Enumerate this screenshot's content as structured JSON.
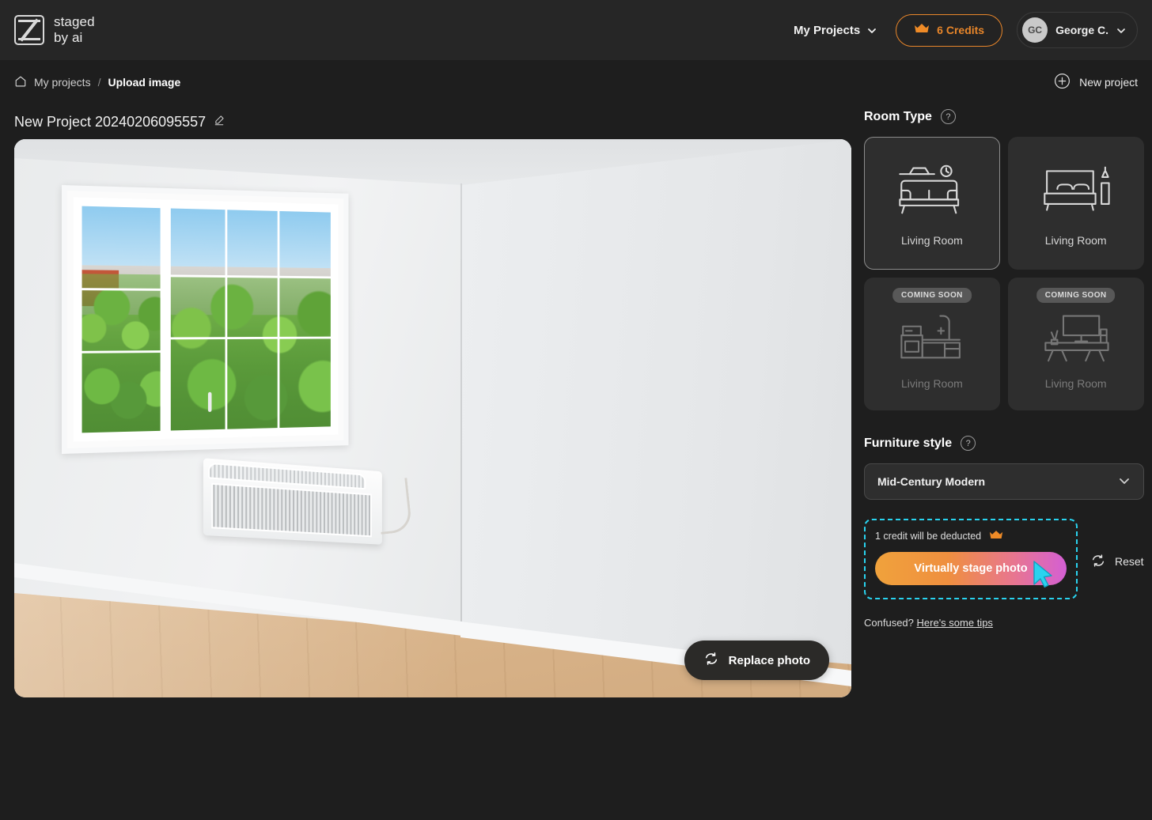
{
  "header": {
    "logo_line1": "staged",
    "logo_line2": "by ai",
    "logo_icon": "staged-by-ai-logo",
    "projects_menu": "My Projects",
    "credits_label": "6 Credits",
    "credits_icon": "crown-icon",
    "avatar_initials": "GC",
    "user_name": "George C.",
    "accent_orange": "#e8862a"
  },
  "breadcrumb": {
    "home_icon": "home-icon",
    "root": "My projects",
    "separator": "/",
    "current": "Upload image",
    "new_project": "New project",
    "new_project_icon": "plus-circle-icon"
  },
  "project": {
    "title": "New Project 20240206095557",
    "edit_icon": "pencil-icon"
  },
  "photo": {
    "replace_label": "Replace photo",
    "replace_icon": "refresh-icon",
    "alt": "Empty living room with white walls, large white grid window showing green foliage, wall mounted air conditioner and light wood floor"
  },
  "room_type": {
    "heading": "Room Type",
    "help_icon": "question-icon",
    "cards": [
      {
        "label": "Living Room",
        "icon": "sofa-icon",
        "selected": true,
        "badge": ""
      },
      {
        "label": "Living Room",
        "icon": "bed-icon",
        "selected": false,
        "badge": ""
      },
      {
        "label": "Living Room",
        "icon": "kitchen-icon",
        "selected": false,
        "badge": "COMING SOON"
      },
      {
        "label": "Living Room",
        "icon": "desk-tv-icon",
        "selected": false,
        "badge": "COMING SOON"
      }
    ]
  },
  "furniture_style": {
    "heading": "Furniture style",
    "help_icon": "question-icon",
    "selected": "Mid-Century Modern",
    "chevron_icon": "chevron-down-icon"
  },
  "cta": {
    "credit_note": "1 credit will be deducted",
    "credit_icon": "crown-icon",
    "stage_label": "Virtually stage photo",
    "reset_label": "Reset",
    "reset_icon": "refresh-icon",
    "highlight_color": "#29d3ef",
    "gradient_from": "#f0a23c",
    "gradient_to": "#d45fd4"
  },
  "tips": {
    "prefix": "Confused?",
    "link": "Here's some tips"
  }
}
